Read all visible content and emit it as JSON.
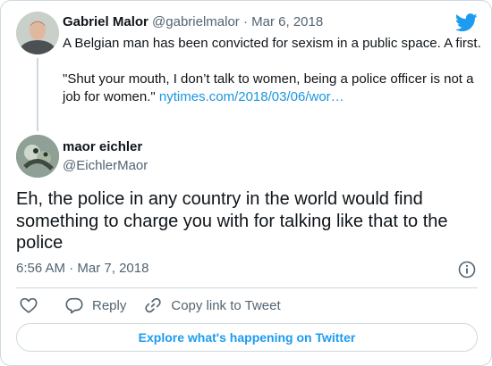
{
  "parent_tweet": {
    "display_name": "Gabriel Malor",
    "handle": "@gabrielmalor",
    "separator": "·",
    "date": "Mar 6, 2018",
    "text_line1": "A Belgian man has been convicted for sexism in a public space. A first.",
    "text_line2": "\"Shut your mouth, I don’t talk to women, being a police officer is not a job for women.\"",
    "link": "nytimes.com/2018/03/06/wor…"
  },
  "tweet": {
    "display_name": "maor eichler",
    "handle": "@EichlerMaor",
    "text": "Eh, the police in any country in the world would find something to charge you with for talking like that to the police",
    "time": "6:56 AM",
    "separator": "·",
    "date": "Mar 7, 2018"
  },
  "actions": {
    "like_icon": "heart-icon",
    "reply_label": "Reply",
    "copy_link_label": "Copy link to Tweet"
  },
  "explore_label": "Explore what's happening on Twitter",
  "colors": {
    "accent": "#1d9bf0",
    "link": "#1b95e0",
    "text": "#0f1419",
    "muted": "#536471",
    "border": "#cfd9de"
  }
}
